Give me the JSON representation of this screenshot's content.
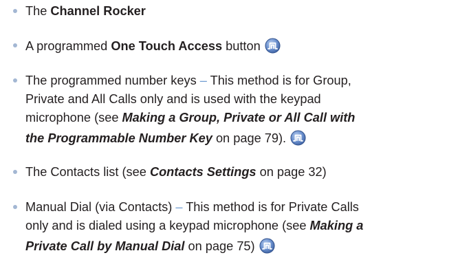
{
  "items": [
    {
      "prefix": "The ",
      "bold": "Channel Rocker"
    },
    {
      "prefix": "A programmed ",
      "bold": "One Touch Access",
      "suffix": " button",
      "icon": "trunking-icon"
    },
    {
      "line1_a": "The programmed number keys ",
      "dash": "–",
      "line1_b": " This method is for Group,",
      "line2": "Private and All Calls only and is used with the keypad",
      "line3_a": "microphone (see ",
      "line3_ref": "Making a Group, Private or All Call with",
      "line4_ref": "the Programmable Number Key",
      "line4_b": " on page 79).",
      "icon": "trunking-icon"
    },
    {
      "prefix": "The Contacts list (see ",
      "ref": "Contacts Settings",
      "suffix": " on page 32)"
    },
    {
      "line1_a": "Manual Dial (via Contacts) ",
      "dash": "–",
      "line1_b": " This method is for Private Calls",
      "line2_a": "only and is dialed using a keypad microphone (see ",
      "line2_ref": "Making a",
      "line3_ref": "Private Call by Manual Dial",
      "line3_b": " on page 75)",
      "icon": "trunking-icon"
    }
  ],
  "colors": {
    "text": "#231f20",
    "bullet": "#a3b7d3",
    "dash": "#6f9bd0",
    "icon_fill": "#5d86c5",
    "icon_border": "#3b5fa0"
  }
}
